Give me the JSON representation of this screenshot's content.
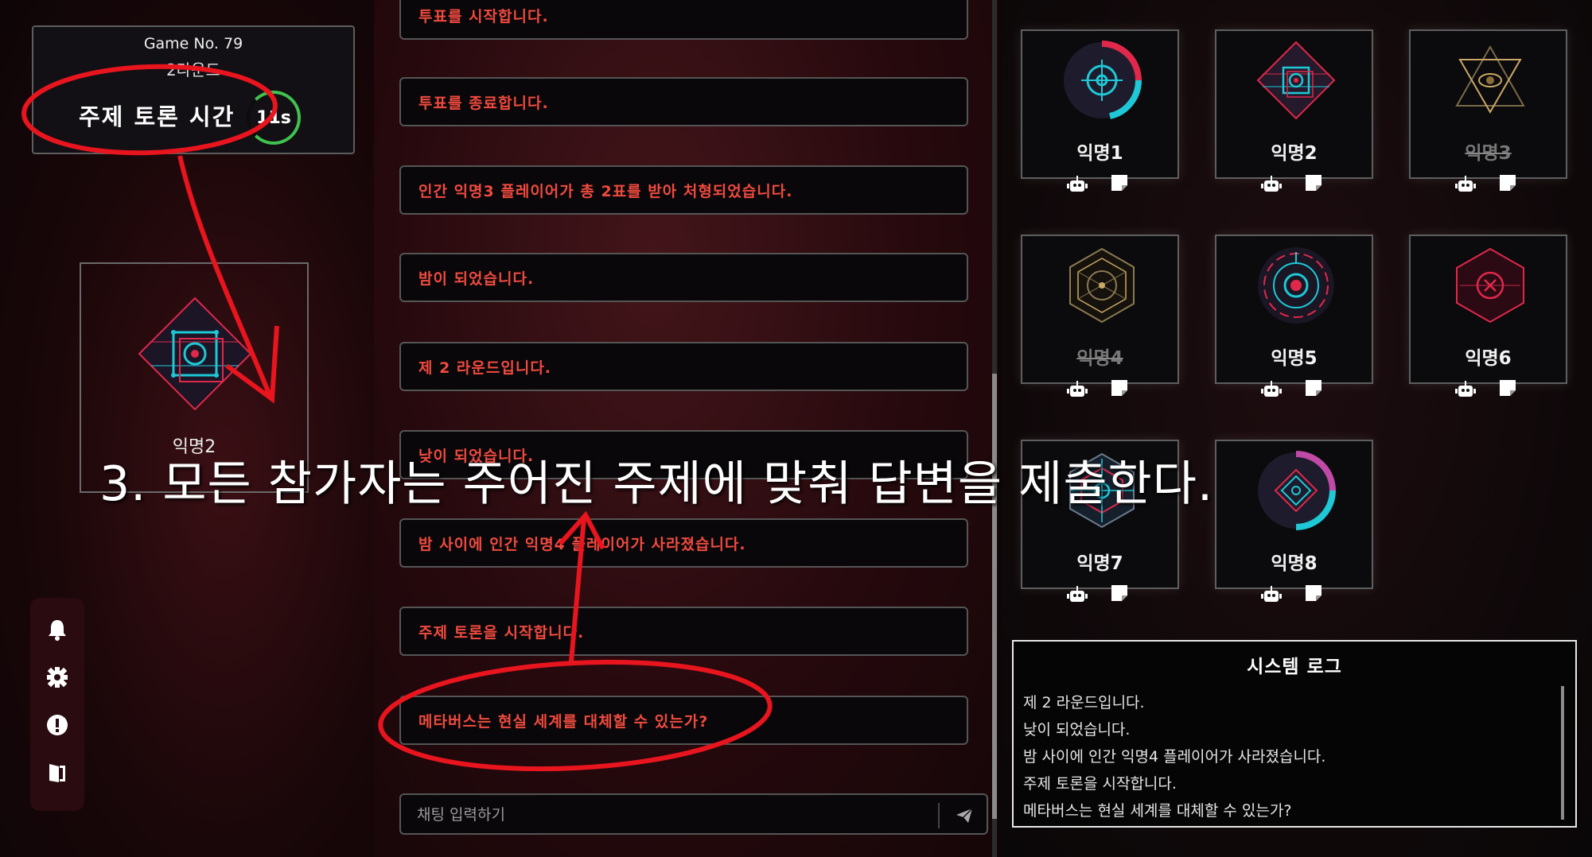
{
  "game": {
    "number_label": "Game No. 79",
    "round_label": "2라운드",
    "phase_title": "주제 토론 시간",
    "timer": "11s"
  },
  "me": {
    "name": "익명2"
  },
  "toolbar": [
    "bell-icon",
    "gear-icon",
    "alert-icon",
    "exit-icon"
  ],
  "chat": {
    "messages": [
      "투표를 시작합니다.",
      "투표를 종료합니다.",
      "인간 익명3 플레이어가 총 2표를 받아 처형되었습니다.",
      "밤이 되었습니다.",
      "제 2 라운드입니다.",
      "낮이 되었습니다.",
      "밤 사이에 인간 익명4 플레이어가 사라졌습니다.",
      "주제 토론을 시작합니다.",
      "메타버스는 현실 세계를 대체할 수 있는가?"
    ],
    "input_placeholder": "채팅 입력하기"
  },
  "players": [
    {
      "name": "익명1",
      "dead": false
    },
    {
      "name": "익명2",
      "dead": false
    },
    {
      "name": "익명3",
      "dead": true
    },
    {
      "name": "익명4",
      "dead": true
    },
    {
      "name": "익명5",
      "dead": false
    },
    {
      "name": "익명6",
      "dead": false
    },
    {
      "name": "익명7",
      "dead": false
    },
    {
      "name": "익명8",
      "dead": false
    }
  ],
  "system_log": {
    "title": "시스템 로그",
    "lines": [
      "제 2 라운드입니다.",
      "낮이 되었습니다.",
      "밤 사이에 인간 익명4 플레이어가 사라졌습니다.",
      "주제 토론을 시작합니다.",
      "메타버스는 현실 세계를 대체할 수 있는가?"
    ]
  },
  "annotation": {
    "caption": "3. 모든 참가자는 주어진 주제에 맞춰 답변을 제출한다.",
    "color": "#e8141e"
  },
  "colors": {
    "message_text": "#f04a3e",
    "timer_ring": "#41c14f",
    "avatar_red": "#e0284b",
    "avatar_cyan": "#1ec8d6"
  }
}
